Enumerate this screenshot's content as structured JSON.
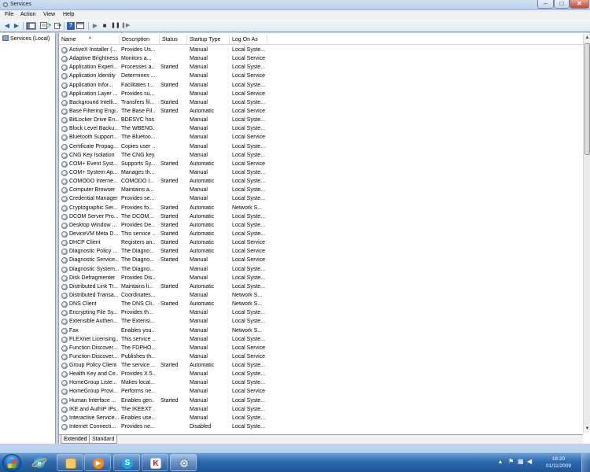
{
  "window": {
    "title": "Services",
    "minimize": "–",
    "maximize": "□",
    "close": "✕"
  },
  "menu": [
    "File",
    "Action",
    "View",
    "Help"
  ],
  "toolbar": {
    "icons": [
      "back-arrow-icon",
      "forward-arrow-icon",
      "show-hide-tree-icon",
      "properties-icon",
      "refresh-icon",
      "export-list-icon",
      "help-icon",
      "console-icon",
      "start-service-icon",
      "stop-service-icon",
      "pause-service-icon",
      "restart-service-icon"
    ]
  },
  "tree": {
    "item": "Services (Local)"
  },
  "columns": {
    "name": "Name",
    "description": "Description",
    "status": "Status",
    "startup": "Startup Type",
    "logon": "Log On As"
  },
  "services": [
    {
      "name": "ActiveX Installer (...",
      "desc": "Provides Us...",
      "status": "",
      "startup": "Manual",
      "logon": "Local Syste..."
    },
    {
      "name": "Adaptive Brightness",
      "desc": "Monitors a...",
      "status": "",
      "startup": "Manual",
      "logon": "Local Service"
    },
    {
      "name": "Application Experi...",
      "desc": "Processes a...",
      "status": "Started",
      "startup": "Manual",
      "logon": "Local Syste..."
    },
    {
      "name": "Application Identity",
      "desc": "Determines ...",
      "status": "",
      "startup": "Manual",
      "logon": "Local Service"
    },
    {
      "name": "Application Infor...",
      "desc": "Facilitates t...",
      "status": "Started",
      "startup": "Manual",
      "logon": "Local Syste..."
    },
    {
      "name": "Application Layer ...",
      "desc": "Provides su...",
      "status": "",
      "startup": "Manual",
      "logon": "Local Service"
    },
    {
      "name": "Background Intelli...",
      "desc": "Transfers fil...",
      "status": "Started",
      "startup": "Manual",
      "logon": "Local Syste..."
    },
    {
      "name": "Base Filtering Engi...",
      "desc": "The Base Fil...",
      "status": "Started",
      "startup": "Automatic",
      "logon": "Local Service"
    },
    {
      "name": "BitLocker Drive En...",
      "desc": "BDESVC hos...",
      "status": "",
      "startup": "Manual",
      "logon": "Local Syste..."
    },
    {
      "name": "Block Level Backu...",
      "desc": "The WBENG...",
      "status": "",
      "startup": "Manual",
      "logon": "Local Syste..."
    },
    {
      "name": "Bluetooth Support...",
      "desc": "The Bluetoo...",
      "status": "",
      "startup": "Manual",
      "logon": "Local Service"
    },
    {
      "name": "Certificate Propag...",
      "desc": "Copies user ...",
      "status": "",
      "startup": "Manual",
      "logon": "Local Syste..."
    },
    {
      "name": "CNG Key Isolation",
      "desc": "The CNG key...",
      "status": "",
      "startup": "Manual",
      "logon": "Local Syste..."
    },
    {
      "name": "COM+ Event Syst...",
      "desc": "Supports Sy...",
      "status": "Started",
      "startup": "Automatic",
      "logon": "Local Service"
    },
    {
      "name": "COM+ System Ap...",
      "desc": "Manages th...",
      "status": "",
      "startup": "Manual",
      "logon": "Local Syste..."
    },
    {
      "name": "COMODO Interne...",
      "desc": "COMODO I...",
      "status": "Started",
      "startup": "Automatic",
      "logon": "Local Syste..."
    },
    {
      "name": "Computer Browser",
      "desc": "Maintains a...",
      "status": "",
      "startup": "Manual",
      "logon": "Local Syste..."
    },
    {
      "name": "Credential Manager",
      "desc": "Provides se...",
      "status": "",
      "startup": "Manual",
      "logon": "Local Syste..."
    },
    {
      "name": "Cryptographic Ser...",
      "desc": "Provides fo...",
      "status": "Started",
      "startup": "Automatic",
      "logon": "Network S..."
    },
    {
      "name": "DCOM Server Pro...",
      "desc": "The DCOM...",
      "status": "Started",
      "startup": "Automatic",
      "logon": "Local Syste..."
    },
    {
      "name": "Desktop Window ...",
      "desc": "Provides De...",
      "status": "Started",
      "startup": "Automatic",
      "logon": "Local Syste..."
    },
    {
      "name": "DeviceVM Meta D...",
      "desc": "This service ...",
      "status": "Started",
      "startup": "Automatic",
      "logon": "Local Syste..."
    },
    {
      "name": "DHCP Client",
      "desc": "Registers an...",
      "status": "Started",
      "startup": "Automatic",
      "logon": "Local Service"
    },
    {
      "name": "Diagnostic Policy ...",
      "desc": "The Diagno...",
      "status": "Started",
      "startup": "Automatic",
      "logon": "Local Service"
    },
    {
      "name": "Diagnostic Service...",
      "desc": "The Diagno...",
      "status": "Started",
      "startup": "Manual",
      "logon": "Local Service"
    },
    {
      "name": "Diagnostic System...",
      "desc": "The Diagno...",
      "status": "",
      "startup": "Manual",
      "logon": "Local Syste..."
    },
    {
      "name": "Disk Defragmenter",
      "desc": "Provides Dis...",
      "status": "",
      "startup": "Manual",
      "logon": "Local Syste..."
    },
    {
      "name": "Distributed Link Tr...",
      "desc": "Maintains li...",
      "status": "Started",
      "startup": "Automatic",
      "logon": "Local Syste..."
    },
    {
      "name": "Distributed Transa...",
      "desc": "Coordinates...",
      "status": "",
      "startup": "Manual",
      "logon": "Network S..."
    },
    {
      "name": "DNS Client",
      "desc": "The DNS Cli...",
      "status": "Started",
      "startup": "Automatic",
      "logon": "Network S..."
    },
    {
      "name": "Encrypting File Sy...",
      "desc": "Provides th...",
      "status": "",
      "startup": "Manual",
      "logon": "Local Syste..."
    },
    {
      "name": "Extensible Authen...",
      "desc": "The Extensi...",
      "status": "",
      "startup": "Manual",
      "logon": "Local Syste..."
    },
    {
      "name": "Fax",
      "desc": "Enables you...",
      "status": "",
      "startup": "Manual",
      "logon": "Network S..."
    },
    {
      "name": "FLEXnet Licensing...",
      "desc": "This service ...",
      "status": "",
      "startup": "Manual",
      "logon": "Local Syste..."
    },
    {
      "name": "Function Discover...",
      "desc": "The FDPHO...",
      "status": "",
      "startup": "Manual",
      "logon": "Local Service"
    },
    {
      "name": "Function Discover...",
      "desc": "Publishes th...",
      "status": "",
      "startup": "Manual",
      "logon": "Local Service"
    },
    {
      "name": "Group Policy Client",
      "desc": "The service ...",
      "status": "Started",
      "startup": "Automatic",
      "logon": "Local Syste..."
    },
    {
      "name": "Health Key and Ce...",
      "desc": "Provides X.5...",
      "status": "",
      "startup": "Manual",
      "logon": "Local Syste..."
    },
    {
      "name": "HomeGroup Liste...",
      "desc": "Makes local...",
      "status": "",
      "startup": "Manual",
      "logon": "Local Syste..."
    },
    {
      "name": "HomeGroup Provi...",
      "desc": "Performs ne...",
      "status": "",
      "startup": "Manual",
      "logon": "Local Service"
    },
    {
      "name": "Human Interface ...",
      "desc": "Enables gen...",
      "status": "Started",
      "startup": "Manual",
      "logon": "Local Syste..."
    },
    {
      "name": "IKE and AuthIP IPs...",
      "desc": "The IKEEXT ...",
      "status": "",
      "startup": "Manual",
      "logon": "Local Syste..."
    },
    {
      "name": "Interactive Service...",
      "desc": "Enables use...",
      "status": "",
      "startup": "Manual",
      "logon": "Local Syste..."
    },
    {
      "name": "Internet Connecti...",
      "desc": "Provides ne...",
      "status": "",
      "startup": "Disabled",
      "logon": "Local Syste..."
    }
  ],
  "tabs": [
    "Extended",
    "Standard"
  ],
  "taskbar": {
    "apps": [
      "internet-explorer-icon",
      "explorer-folder-icon",
      "media-player-icon",
      "skype-icon",
      "kaspersky-icon",
      "services-gear-icon"
    ],
    "skype_glyph": "S",
    "kaspersky_glyph": "K"
  },
  "clock": {
    "time": "18:20",
    "date": "01/11/2009"
  }
}
